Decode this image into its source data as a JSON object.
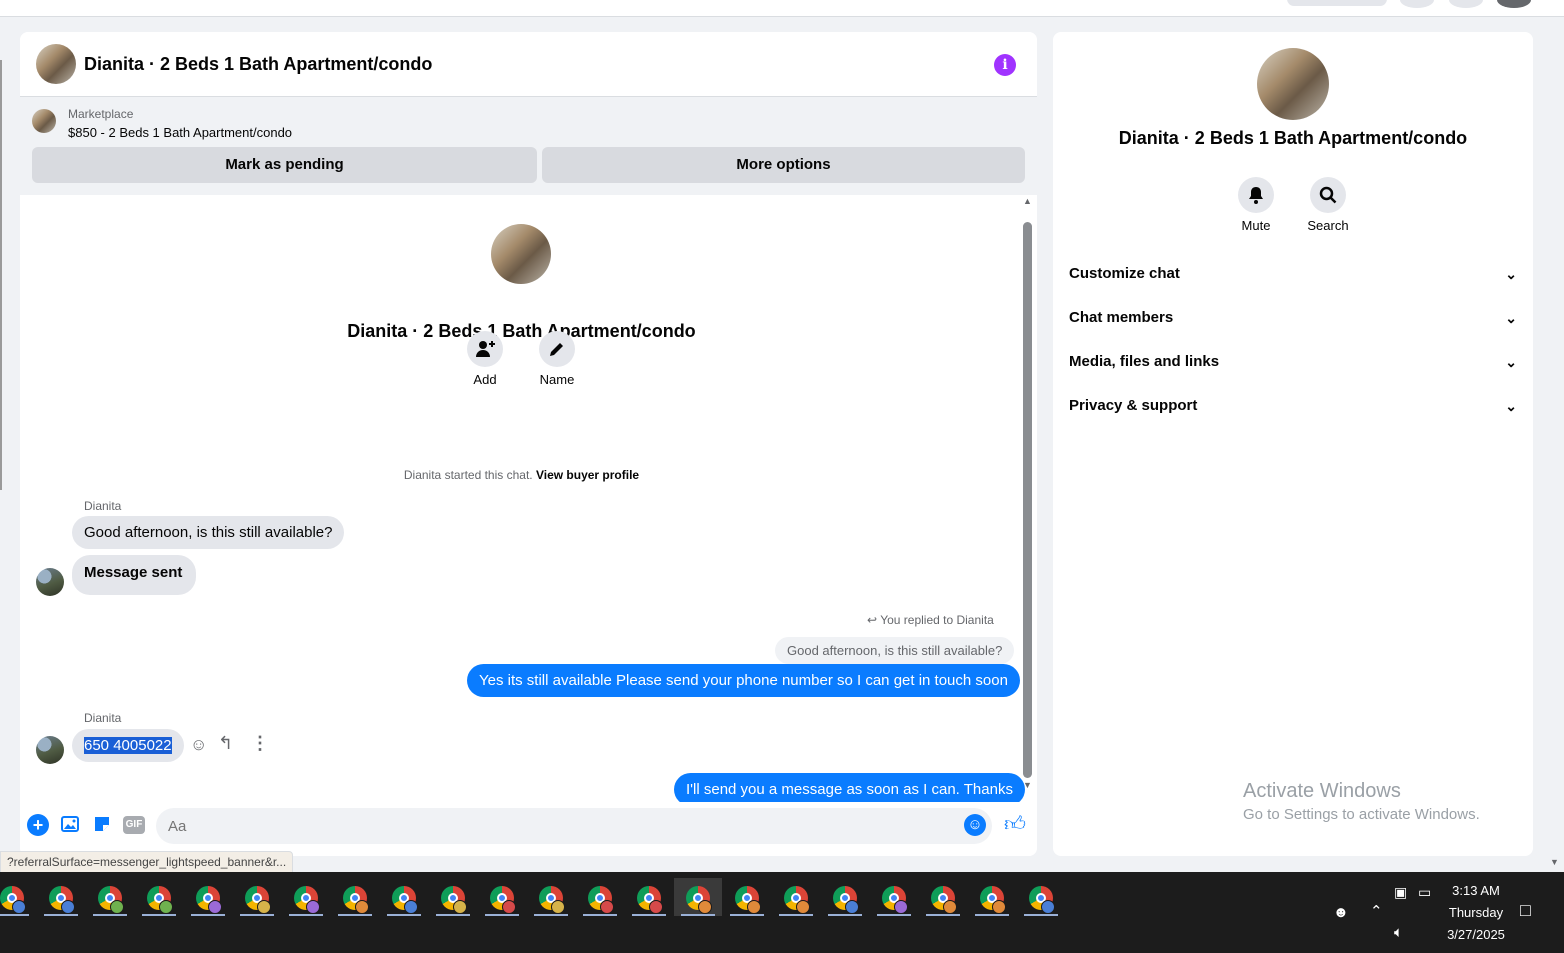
{
  "chat": {
    "title": "Dianita · 2 Beds 1 Bath Apartment/condo",
    "info_icon": "i",
    "listing": {
      "label": "Marketplace",
      "price_title": "$850 - 2 Beds 1 Bath Apartment/condo"
    },
    "buttons": {
      "mark_pending": "Mark as pending",
      "more_options": "More options"
    },
    "intro": {
      "title": "Dianita · 2 Beds 1 Bath Apartment/condo",
      "add_label": "Add",
      "name_label": "Name",
      "started_text": "Dianita started this chat.",
      "view_profile": "View buyer profile"
    },
    "messages": {
      "sender1": "Dianita",
      "in1": "Good afternoon, is this still available?",
      "in2": "Message sent",
      "replied_to": "You replied to Dianita",
      "quoted": "Good afternoon, is this still available?",
      "out1": "Yes its still available Please send your phone number so I can get in touch soon",
      "sender2": "Dianita",
      "in3": "650 4005022",
      "out2": "I'll send you a message as soon as I can. Thanks"
    },
    "composer": {
      "placeholder": "Aa",
      "gif_label": "GIF"
    },
    "url_hint": "?referralSurface=messenger_lightspeed_banner&r..."
  },
  "side": {
    "title": "Dianita · 2 Beds 1 Bath Apartment/condo",
    "mute_label": "Mute",
    "search_label": "Search",
    "sections": [
      "Customize chat",
      "Chat members",
      "Media, files and links",
      "Privacy & support"
    ],
    "watermark_title": "Activate Windows",
    "watermark_sub": "Go to Settings to activate Windows."
  },
  "taskbar": {
    "time": "3:13 AM",
    "day": "Thursday",
    "date": "3/27/2025",
    "profile_colors": [
      "#4a7fd6",
      "#4a7fd6",
      "#6fb24f",
      "#6fb24f",
      "#9b6ad6",
      "#d6b34a",
      "#9b6ad6",
      "#e08a3a",
      "#4a7fd6",
      "#d6b34a",
      "#d64a4a",
      "#d6b34a",
      "#d64a4a",
      "#d64a4a",
      "#e08a3a",
      "#e08a3a",
      "#e08a3a",
      "#4a7fd6",
      "#9b6ad6",
      "#e08a3a",
      "#e08a3a",
      "#4a7fd6"
    ]
  },
  "colors": {
    "accent": "#0a7cff",
    "info": "#a033ff",
    "background": "#f0f2f5"
  }
}
